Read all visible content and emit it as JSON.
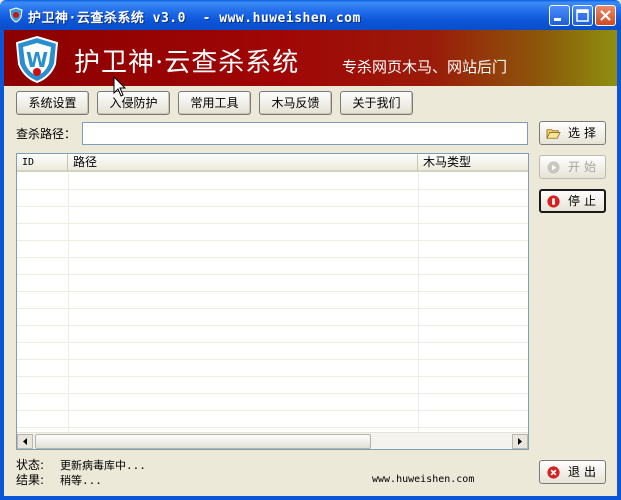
{
  "window": {
    "title": "护卫神·云查杀系统 v3.0  - www.huweishen.com"
  },
  "banner": {
    "title": "护卫神·云查杀系统",
    "subtitle": "专杀网页木马、网站后门"
  },
  "toolbar": {
    "buttons": [
      "系统设置",
      "入侵防护",
      "常用工具",
      "木马反馈",
      "关于我们"
    ]
  },
  "path": {
    "label": "查杀路径：",
    "value": ""
  },
  "side": {
    "select_label": "选择",
    "start_label": "开始",
    "stop_label": "停止",
    "exit_label": "退出"
  },
  "list": {
    "columns": [
      "ID",
      "路径",
      "木马类型"
    ]
  },
  "footer": {
    "status_label": "状态:",
    "status_value": "更新病毒库中...",
    "result_label": "结果:",
    "result_value": "稍等...",
    "site": "www.huweishen.com"
  },
  "colors": {
    "titlebar": "#0b55d8",
    "banner": "#a00606",
    "face": "#ece9d8"
  },
  "icons": [
    "app-shield-icon",
    "minimize-icon",
    "maximize-icon",
    "close-icon",
    "folder-open-icon",
    "play-icon",
    "stop-icon",
    "exit-icon"
  ]
}
